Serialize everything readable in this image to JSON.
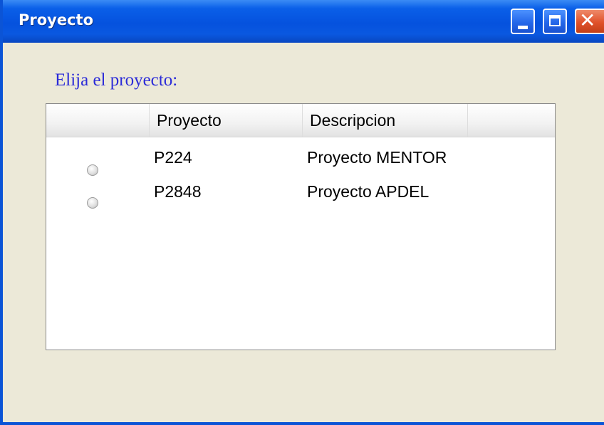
{
  "window": {
    "title": "Proyecto",
    "controls": {
      "close_glyph": "✕"
    }
  },
  "prompt": "Elija el proyecto:",
  "grid": {
    "columns": [
      "",
      "Proyecto",
      "Descripcion",
      ""
    ],
    "rows": [
      {
        "selected": false,
        "proyecto": "P224",
        "descripcion": "Proyecto MENTOR"
      },
      {
        "selected": false,
        "proyecto": "P2848",
        "descripcion": "Proyecto APDEL"
      }
    ]
  }
}
